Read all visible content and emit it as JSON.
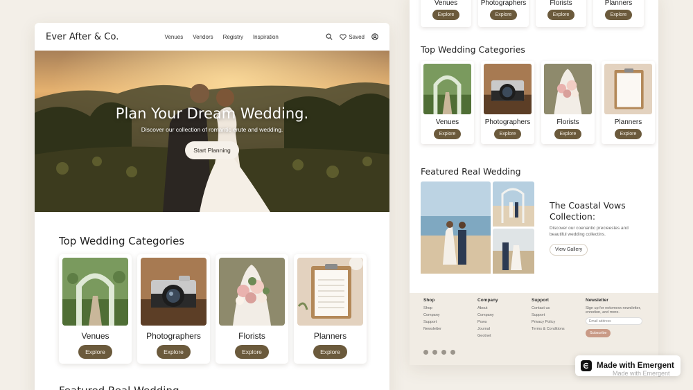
{
  "left": {
    "brand": "Ever After & Co.",
    "nav": [
      "Venues",
      "Vendors",
      "Registry",
      "Inspiration"
    ],
    "saved_label": "Saved",
    "hero": {
      "title": "Plan Your Dream Wedding.",
      "subtitle": "Discover our collection of romantic erute and wedding.",
      "cta": "Start Planning"
    },
    "section_title": "Top Wedding Categories",
    "categories": [
      {
        "label": "Venues",
        "button": "Explore"
      },
      {
        "label": "Photographers",
        "button": "Explore"
      },
      {
        "label": "Florists",
        "button": "Explore"
      },
      {
        "label": "Planners",
        "button": "Explore"
      }
    ],
    "next_section_partial": "Featured Real Wedding"
  },
  "right": {
    "top_cards": [
      {
        "label": "Venues",
        "button": "Explore"
      },
      {
        "label": "Photographers",
        "button": "Explore"
      },
      {
        "label": "Florists",
        "button": "Explore"
      },
      {
        "label": "Planners",
        "button": "Explore"
      }
    ],
    "section_title": "Top Wedding Categories",
    "categories": [
      {
        "label": "Venues",
        "button": "Explore"
      },
      {
        "label": "Photographers",
        "button": "Explore"
      },
      {
        "label": "Florists",
        "button": "Explore"
      },
      {
        "label": "Planners",
        "button": "Explore"
      }
    ],
    "featured": {
      "title": "Featured Real Wedding",
      "heading": "The Coastal Vows Collection:",
      "description": "Discover our coenantic precieestes and beautiful wedding collectins.",
      "button": "View Gallery"
    },
    "footer": {
      "shop": {
        "title": "Shop",
        "items": [
          "Shop",
          "Company",
          "Support",
          "Newsletter"
        ]
      },
      "company": {
        "title": "Company",
        "items": [
          "About",
          "Company",
          "Pows",
          "Journal",
          "Geotnet"
        ]
      },
      "support": {
        "title": "Support",
        "items": [
          "Contact us",
          "Support",
          "Privacy Policy",
          "Terms & Conditions"
        ]
      },
      "newsletter": {
        "title": "Newsletter",
        "text": "Sign up for eotomexx newsletter, ennotion, and more.",
        "placeholder": "Email address",
        "button": "Subscribe"
      }
    }
  },
  "badge": {
    "label": "Made with Emergent",
    "ghost": "Made with Emergent"
  },
  "colors": {
    "accent_brown": "#6b5a3c",
    "background": "#f3efe8",
    "subscribe": "#c99a86"
  }
}
